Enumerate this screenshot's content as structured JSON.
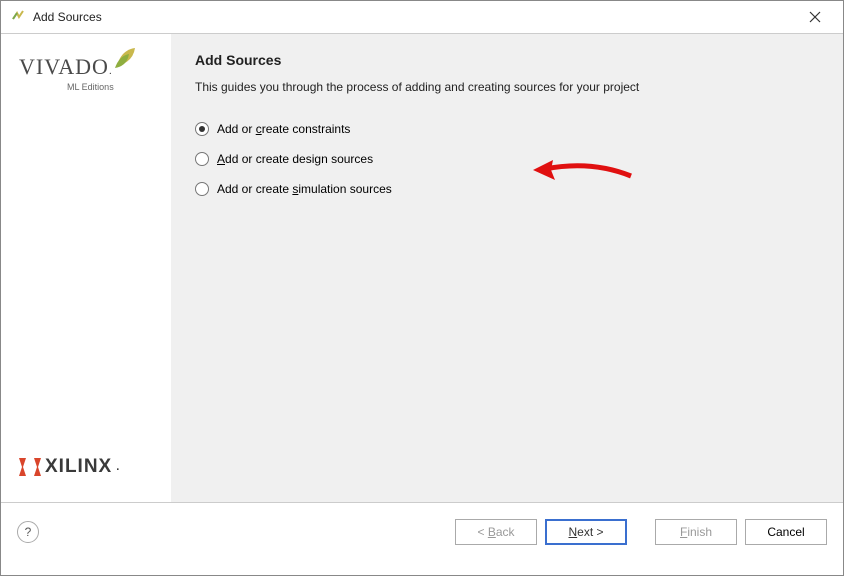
{
  "window": {
    "title": "Add Sources"
  },
  "sidebar": {
    "vivado": "VIVADO",
    "ml": "ML Editions",
    "xilinx": "XILINX"
  },
  "content": {
    "heading": "Add Sources",
    "subtitle": "This guides you through the process of adding and creating sources for your project",
    "options": [
      {
        "pre": "Add or ",
        "mn": "c",
        "post": "reate constraints",
        "selected": true
      },
      {
        "pre": "",
        "mn": "A",
        "post": "dd or create design sources",
        "selected": false
      },
      {
        "pre": "Add or create ",
        "mn": "s",
        "post": "imulation sources",
        "selected": false
      }
    ]
  },
  "footer": {
    "help": "?",
    "back_pre": "< ",
    "back_mn": "B",
    "back_post": "ack",
    "next_mn": "N",
    "next_post": "ext >",
    "finish_mn": "F",
    "finish_post": "inish",
    "cancel": "Cancel"
  }
}
